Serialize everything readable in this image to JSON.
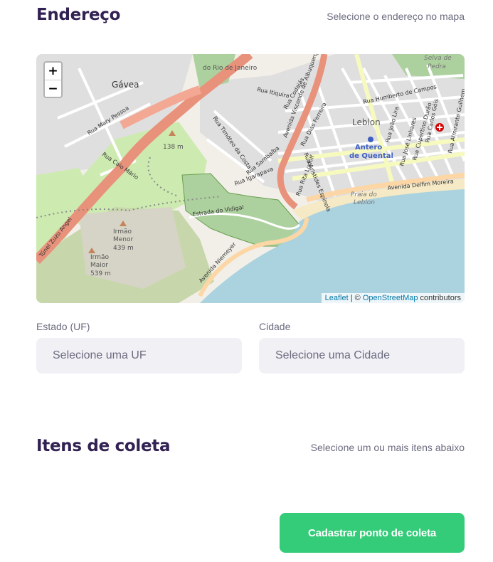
{
  "address": {
    "title": "Endereço",
    "hint": "Selecione o endereço no mapa"
  },
  "map": {
    "zoom_in": "+",
    "zoom_out": "−",
    "attribution": {
      "leaflet": "Leaflet",
      "separator": " | © ",
      "osm": "OpenStreetMap",
      "suffix": " contributors"
    },
    "labels": {
      "gavea": "Gávea",
      "rio_de_janeiro": "do Rio de Janeiro",
      "leblon": "Leblon",
      "antero": "Antero",
      "de_quental": "de Quental",
      "praia_do": "Praia do",
      "leblon_beach": "Leblon",
      "selva_de": "Selva de",
      "pedra": "Pedra",
      "alt_138": "138 m",
      "irmao_menor": "Irmão",
      "menor": "Menor",
      "alt_439": "439 m",
      "irmao_maior": "Irmão",
      "maior": "Maior",
      "alt_539": "539 m",
      "rua_mary_pessoa": "Rua Mary Pessoa",
      "rua_caio_mario": "Rua Caio Mário",
      "tunel_zuzu_angel": "Túnel Zuzu Angel",
      "estrada_do_vidigal": "Estrada do Vidigal",
      "avenida_niemeyer": "Avenida Niemeyer",
      "avenida_visconde": "Avenida Visconde de Albuquerque",
      "rua_igarapava": "Rua Igarapava",
      "rua_sambaiba": "Rua Sambaíba",
      "rua_timoteo": "Rua Timóteo da Costa",
      "rua_itiquira": "Rua Itiquira",
      "rua_codajas": "Rua Codajás",
      "rua_dias_ferreira": "Rua Dias Ferreira",
      "rua_humberto": "Rua Humberto de Campos",
      "rua_aristides": "Rua Aristides Espínola",
      "rua_rita_ludolf": "Rua Rita Ludolf",
      "rua_joao_lira": "Rua João Lira",
      "rua_jose_linhares": "Rua José Linhares",
      "rua_cupertino": "Rua Cupertino Durão",
      "rua_carlos_gois": "Rua Carlos Góis",
      "rua_almirante": "Rua Almirante Guilhem",
      "avenida_delfim": "Avenida Delfim Moreira"
    }
  },
  "fields": {
    "uf": {
      "label": "Estado (UF)",
      "placeholder": "Selecione uma UF"
    },
    "city": {
      "label": "Cidade",
      "placeholder": "Selecione uma Cidade"
    }
  },
  "items": {
    "title": "Itens de coleta",
    "hint": "Selecione um ou mais itens abaixo"
  },
  "submit": {
    "label": "Cadastrar ponto de coleta"
  },
  "colors": {
    "primary": "#34CB79",
    "title": "#322153",
    "text": "#6C6C80",
    "input_bg": "#F0F0F5"
  }
}
